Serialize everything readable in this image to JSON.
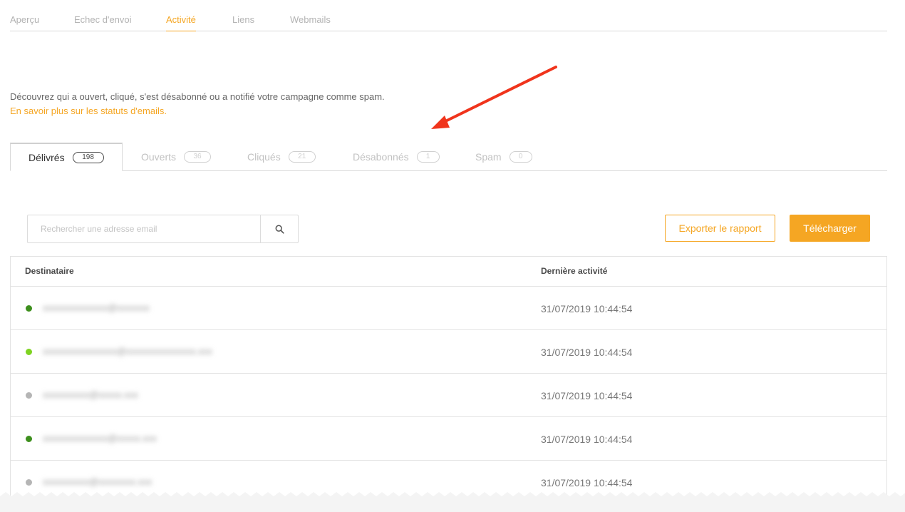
{
  "top_nav": {
    "tabs": [
      "Aperçu",
      "Echec d'envoi",
      "Activité",
      "Liens",
      "Webmails"
    ],
    "active_index": 2
  },
  "description": {
    "text": "Découvrez qui a ouvert, cliqué, s'est désabonné ou a notifié votre campagne comme spam.",
    "link": "En savoir plus sur les statuts d'emails."
  },
  "status_tabs": [
    {
      "label": "Délivrés",
      "count": "198"
    },
    {
      "label": "Ouverts",
      "count": "36"
    },
    {
      "label": "Cliqués",
      "count": "21"
    },
    {
      "label": "Désabonnés",
      "count": "1"
    },
    {
      "label": "Spam",
      "count": "0"
    }
  ],
  "search": {
    "placeholder": "Rechercher une adresse email"
  },
  "actions": {
    "export": "Exporter le rapport",
    "download": "Télécharger"
  },
  "table": {
    "headers": [
      "Destinataire",
      "Dernière activité"
    ],
    "rows": [
      {
        "email": "xxxxxxxxxxxxxx@xxxxxxx",
        "date": "31/07/2019 10:44:54",
        "status_color": "#3d8f1d"
      },
      {
        "email": "xxxxxxxxxxxxxxxx@xxxxxxxxxxxxxxx.xxx",
        "date": "31/07/2019 10:44:54",
        "status_color": "#7ed321"
      },
      {
        "email": "xxxxxxxxxx@xxxxx.xxx",
        "date": "31/07/2019 10:44:54",
        "status_color": "#b5b5b5"
      },
      {
        "email": "xxxxxxxxxxxxxx@xxxxx.xxx",
        "date": "31/07/2019 10:44:54",
        "status_color": "#3d8f1d"
      },
      {
        "email": "xxxxxxxxxx@xxxxxxxx.xxx",
        "date": "31/07/2019 10:44:54",
        "status_color": "#b5b5b5"
      }
    ]
  },
  "colors": {
    "accent": "#f5a623",
    "annotation_arrow": "#f0341c"
  }
}
